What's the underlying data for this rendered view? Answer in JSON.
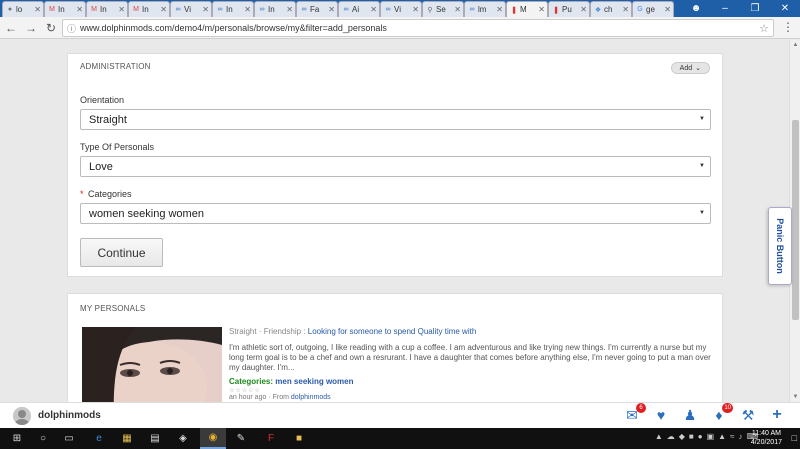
{
  "browser": {
    "tabs": [
      {
        "label": "lo",
        "icon": "generic-icon"
      },
      {
        "label": "In",
        "icon": "gmail-icon"
      },
      {
        "label": "In",
        "icon": "gmail-icon"
      },
      {
        "label": "In",
        "icon": "gmail-icon"
      },
      {
        "label": "Vi",
        "icon": "dolphin-icon"
      },
      {
        "label": "In",
        "icon": "dolphin-icon"
      },
      {
        "label": "In",
        "icon": "dolphin-icon"
      },
      {
        "label": "Fa",
        "icon": "dolphin-icon"
      },
      {
        "label": "Ai",
        "icon": "dolphin-icon"
      },
      {
        "label": "Vi",
        "icon": "dolphin-icon"
      },
      {
        "label": "Se",
        "icon": "search-icon"
      },
      {
        "label": "lm",
        "icon": "dolphin-icon"
      },
      {
        "label": "M",
        "icon": "pause-icon"
      },
      {
        "label": "Pu",
        "icon": "pause-icon"
      },
      {
        "label": "ch",
        "icon": "puzzle-icon"
      },
      {
        "label": "ge",
        "icon": "google-icon"
      }
    ],
    "active_tab_index": 12,
    "url": "www.dolphinmods.com/demo4/m/personals/browse/my&filter=add_personals"
  },
  "admin": {
    "title": "ADMINISTRATION",
    "add_label": "Add",
    "orientation_label": "Orientation",
    "orientation_value": "Straight",
    "type_label": "Type Of Personals",
    "type_value": "Love",
    "categories_required": "*",
    "categories_label": "Categories",
    "categories_value": "women seeking women",
    "continue_label": "Continue"
  },
  "my_personals": {
    "title": "MY PERSONALS",
    "entry": {
      "orientation": "Straight",
      "type": "Friendship",
      "headline": "Looking for someone to spend Quality time with",
      "description": "I'm athletic sort of, outgoing, I like reading with a cup a coffee. I am adventurous and like trying new things. I'm currently a nurse but my long term goal is to be a chef and own a resrurant.  I have a daughter that comes before anything else, I'm never going to put a man over my daughter.  I'm...",
      "categories_label": "Categories:",
      "categories_value": "men seeking women",
      "stars": "☆☆☆☆☆",
      "time_text": "an hour ago",
      "from_text": "From",
      "author": "dolphinmods"
    }
  },
  "panic_button": "Panic Button",
  "bottom_bar": {
    "username": "dolphinmods",
    "mail_badge": "6",
    "notif_badge": "10"
  },
  "taskbar": {
    "time": "11:40 AM",
    "date": "4/20/2017"
  },
  "colors": {
    "accent": "#2a6fbf",
    "badge": "#e02020",
    "category_green": "#1e8a1e"
  }
}
